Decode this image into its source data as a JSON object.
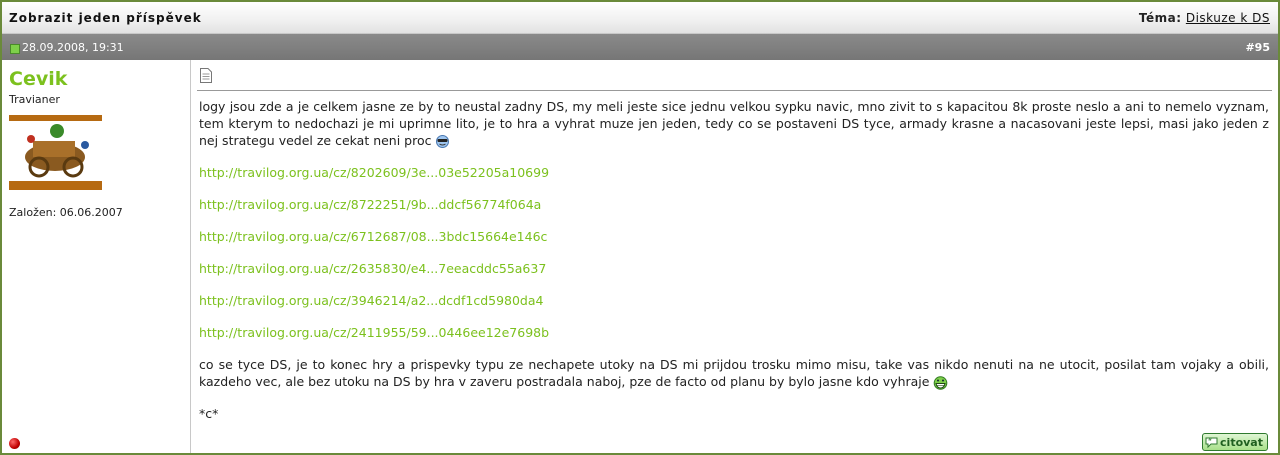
{
  "header": {
    "title": "Zobrazit jeden příspěvek",
    "topic_label": "Téma:",
    "topic_link": "Diskuze k DS"
  },
  "post": {
    "datetime": "28.09.2008, 19:31",
    "number": "#95",
    "author": {
      "name": "Cevik",
      "rank": "Travianer",
      "joined": "Založen: 06.06.2007",
      "status": "offline"
    },
    "paragraph1": "logy jsou zde a je celkem jasne ze by to neustal zadny DS, my meli jeste sice jednu velkou sypku navic, mno zivit to s kapacitou 8k proste neslo a ani to nemelo vyznam, tem kterym to nedochazi je mi uprimne lito, je to hra a vyhrat muze jen jeden, tedy co se postaveni DS tyce, armady krasne a nacasovani jeste lepsi, masi jako jeden z nej strategu vedel ze cekat neni proc",
    "links": [
      "http://travilog.org.ua/cz/8202609/3e...03e52205a10699",
      "http://travilog.org.ua/cz/8722251/9b...ddcf56774f064a",
      "http://travilog.org.ua/cz/6712687/08...3bdc15664e146c",
      "http://travilog.org.ua/cz/2635830/e4...7eeacddc55a637",
      "http://travilog.org.ua/cz/3946214/a2...dcdf1cd5980da4",
      "http://travilog.org.ua/cz/2411955/59...0446ee12e7698b"
    ],
    "paragraph2": "co se tyce DS, je to konec hry a prispevky typu ze nechapete utoky na DS mi prijdou trosku mimo misu, take vas nikdo nenuti na ne utocit, posilat tam vojaky a obili, kazdeho vec, ale bez utoku na DS by hra v zaveru postradala naboj, pze de facto od planu by bylo jasne kdo vyhraje",
    "signature": "*c*",
    "quote_button": "citovat"
  },
  "colors": {
    "accent_green": "#7cc11e",
    "post_bar": "#808080",
    "border": "#6a8a3a"
  }
}
